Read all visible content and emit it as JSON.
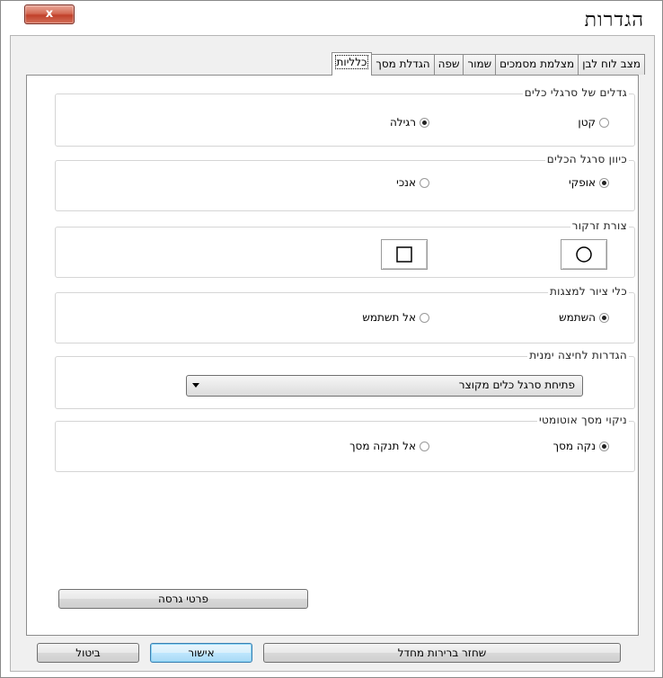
{
  "window": {
    "title": "הגדרות",
    "close_label": "x"
  },
  "tabs": [
    {
      "label": "כלליות",
      "active": true
    },
    {
      "label": "הגדלת מסך",
      "active": false
    },
    {
      "label": "שפה",
      "active": false
    },
    {
      "label": "שמור",
      "active": false
    },
    {
      "label": "מצלמת מסמכים",
      "active": false
    },
    {
      "label": "מצב לוח לבן",
      "active": false
    }
  ],
  "toolbar_size": {
    "label": "גדלים של סרגלי כלים",
    "options": [
      {
        "label": "קטן",
        "selected": false
      },
      {
        "label": "רגילה",
        "selected": true
      }
    ]
  },
  "toolbar_orientation": {
    "label": "כיוון סרגל הכלים",
    "options": [
      {
        "label": "אופקי",
        "selected": true
      },
      {
        "label": "אנכי",
        "selected": false
      }
    ]
  },
  "highlight_shape": {
    "label": "צורת זרקור",
    "options": [
      {
        "icon": "circle-icon"
      },
      {
        "icon": "square-icon"
      }
    ]
  },
  "presentation_tools": {
    "label": "כלי ציור למצגות",
    "options": [
      {
        "label": "השתמש",
        "selected": true
      },
      {
        "label": "אל תשתמש",
        "selected": false
      }
    ]
  },
  "right_click": {
    "label": "הגדרות לחיצה ימנית",
    "selected_value": "פתיחת סרגל כלים מקוצר"
  },
  "auto_clear": {
    "label": "ניקוי מסך אוטומטי",
    "options": [
      {
        "label": "נקה מסך",
        "selected": true
      },
      {
        "label": "אל תנקה מסך",
        "selected": false
      }
    ]
  },
  "version_button": "פרטי גרסה",
  "footer": {
    "restore_defaults": "שחזר ברירות מחדל",
    "ok": "אישור",
    "cancel": "ביטול"
  }
}
